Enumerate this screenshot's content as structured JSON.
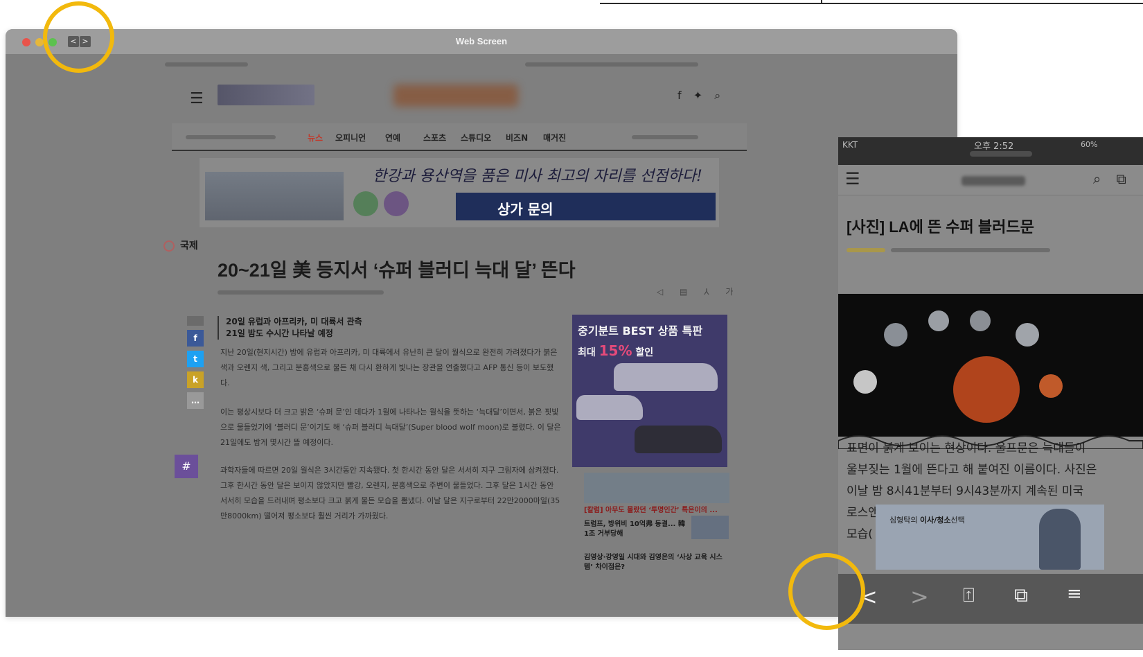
{
  "window": {
    "title": "Web Screen",
    "back_glyph": "<",
    "forward_glyph": ">"
  },
  "site": {
    "nav": [
      "뉴스",
      "오피니언",
      "연예",
      "스포츠",
      "스튜디오",
      "비즈N",
      "매거진"
    ],
    "banner_slogan": "한강과 용산역을 품은 미사 최고의 자리를 선점하다!",
    "banner_cta": "상가 문의",
    "section": "국제",
    "headline": "20~21일 美 등지서 ‘슈퍼 블러디 늑대 달’ 뜬다",
    "subhead_1": "20일 유럽과 아프리카, 미 대륙서 관측",
    "subhead_2": "21일 밤도 수시간 나타날 예정",
    "paragraphs": [
      "지난 20일(현지시간) 밤에 유럽과 아프리카, 미 대륙에서 유난히 큰 달이 월식으로 완전히 가려졌다가 붉은 색과 오렌지 색, 그리고 분홍색으로 물든 채 다시 환하게 빛나는 장관을 연출했다고 AFP 통신 등이 보도했다.",
      "이는 평상시보다 더 크고 밝은 ‘슈퍼 문’인 데다가 1월에 나타나는 월식을 뜻하는 ‘늑대달’이면서, 붉은 핏빛으로 물들었기에 ‘블러디 문’이기도 해 ‘슈퍼 블러디 늑대달’(Super blood wolf moon)로 불렸다. 이 달은 21일에도 밤게 몇시간 뜰 예정이다.",
      "과학자들에 따르면 20일 월식은 3시간동안 지속됐다. 첫 한시간 동안 달은 서서히 지구 그림자에 삼켜졌다. 그후 한시간 동안 달은 보이지 않았지만 빨강, 오렌지, 분홍색으로 주변이 물들었다. 그후 달은 1시간 동안 서서히 모습을 드러내며 평소보다 크고 붉게 물든 모습을 뽐냈다. 이날 달은 지구로부터 22만2000마일(35만8000km) 떨어져 평소보다 훨씬 거리가 가까웠다."
    ],
    "side_ad_title": "중기분트 BEST 상품 특판",
    "side_ad_prefix": "최대",
    "side_ad_percent": "15%",
    "side_ad_suffix": "할인",
    "side_link_1": "[칼럼] 아무도 몰랐던 ‘투명인간’ 특은이의 ...",
    "side_link_2": "트럼프, 방위비 10억弗 동결... 韓 1조 거부당해",
    "side_link_3": "김영상·강영일 시대와 김영은의 ‘사상 교육 시스템’ 차이점은?",
    "social_icons": "f ✦ ⌕",
    "hashtag": "#"
  },
  "mobile": {
    "carrier": "KKT",
    "time": "오후 2:52",
    "battery": "60%",
    "title": "[사진] LA에 뜬 수퍼 블러드문",
    "text_1": "표면이 붉게 보이는 현상이다. 울프문은 늑대들이",
    "text_2": "울부짖는 1월에 뜬다고 해 붙여진 이름이다. 사진은",
    "text_3": "이날 밤 8시41분부터 9시43분까지 계속된 미국",
    "text_4": "로스앤",
    "text_5": "모습(",
    "ad_text_prefix": "심형탁의 ",
    "ad_text_bold": "이사/청소",
    "ad_text_suffix": "선택",
    "toolbar": {
      "back": "<",
      "forward": ">",
      "share_icon": "share-icon",
      "tabs_icon": "tabs-icon",
      "menu_icon": "menu-icon"
    }
  },
  "highlight_color": "#f2b90d"
}
